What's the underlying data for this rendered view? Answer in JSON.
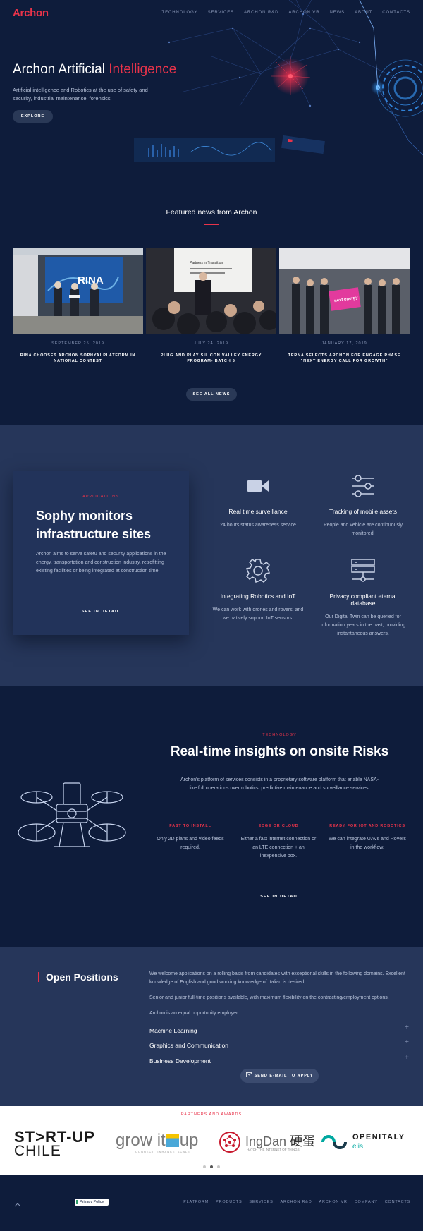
{
  "header": {
    "logo": "Archon",
    "nav": [
      "Technology",
      "Services",
      "Archon R&D",
      "Archon VR",
      "News",
      "About",
      "Contacts"
    ]
  },
  "hero": {
    "title_main": "Archon Artificial ",
    "title_accent": "Intelligence",
    "subtitle": "Artificial intelligence and Robotics at the use of safety and security, industrial maintenance, forensics.",
    "button": "Explore"
  },
  "news": {
    "title": "Featured news from Archon",
    "items": [
      {
        "date": "September 25, 2019",
        "headline": "RINA chooses Archon SophyAI Platform in National Contest",
        "image_text": "RINA"
      },
      {
        "date": "July 24, 2019",
        "headline": "Plug and Play Silicon Valley Energy Program- Batch 5",
        "image_text": "Partners in Transition"
      },
      {
        "date": "January 17, 2019",
        "headline": "Terna selects Archon for Engage phase \"Next Energy Call for Growth\"",
        "image_text": "next energy"
      }
    ],
    "button": "See all news"
  },
  "applications": {
    "kicker": "Applications",
    "title": "Sophy monitors infrastructure sites",
    "description": "Archon aims to serve safetu and security applications in the energy, transportation and construction industry, retrofitting existing facilities or being integrated at construction time.",
    "button": "See in detail",
    "features": [
      {
        "icon": "video-camera-icon",
        "title": "Real time surveillance",
        "desc": "24 hours status awareness service"
      },
      {
        "icon": "sliders-icon",
        "title": "Tracking of mobile assets",
        "desc": "People and vehicle are continuously monitored."
      },
      {
        "icon": "gear-icon",
        "title": "Integrating Robotics and IoT",
        "desc": "We can work with drones and rovers, and we natively support IoT sensors."
      },
      {
        "icon": "server-icon",
        "title": "Privacy compliant eternal database",
        "desc": "Our Digital Twin can be queried for information years in the past, providing instantaneous answers."
      }
    ]
  },
  "technology": {
    "kicker": "Technology",
    "title": "Real-time insights on onsite Risks",
    "description": "Archon's platform of services consists in a proprietary software platform that enable NASA-like full operations over robotics, predictive maintenance and surveillance services.",
    "columns": [
      {
        "kicker": "Fast to install",
        "desc": "Only 2D plans and video feeds required."
      },
      {
        "kicker": "Edge or Cloud",
        "desc": "Either a fast internet connection or an LTE connection + an inexpensive box."
      },
      {
        "kicker": "Ready for IoT and Robotics",
        "desc": "We can integrate UAVs and Rovers in the workflow."
      }
    ],
    "button": "See in detail"
  },
  "positions": {
    "title": "Open Positions",
    "paragraphs": [
      "We welcome applications on a rolling basis from candidates with exceptional skills in the following domains. Excellent knowledge of English and good working knowledge of Italian is desired.",
      "Senior and junior full-time positions available, with maximum flexibility on the contracting/employment options.",
      "Archon is an equal opportunity employer."
    ],
    "items": [
      "Machine Learning",
      "Graphics and Communication",
      "Business Development"
    ],
    "expand_symbol": "+",
    "button": "Send e-mail to apply"
  },
  "partners": {
    "kicker": "Partners and Awards",
    "logos": {
      "startup": {
        "line1_a": "ST",
        "line1_b": "RT-UP",
        "line2": "CHILE"
      },
      "growitup": {
        "main_a": "grow it",
        "main_b": "up",
        "sub": "CONNECT_ENHANCE_SCALE"
      },
      "ingdan": {
        "main": "IngDan",
        "cn": "硬蛋",
        "sub": "HATCH THE INTERNET OF THINGS"
      },
      "openitaly": {
        "main": "OPENITALY",
        "sub": "elis"
      }
    }
  },
  "footer": {
    "privacy": "Privacy Policy",
    "nav": [
      "Platform",
      "Products",
      "Services",
      "Archon R&D",
      "Archon VR",
      "Company",
      "Contacts"
    ]
  },
  "colors": {
    "accent": "#e8334a",
    "dark_bg": "#0e1c3b",
    "mid_bg": "#26365a"
  }
}
